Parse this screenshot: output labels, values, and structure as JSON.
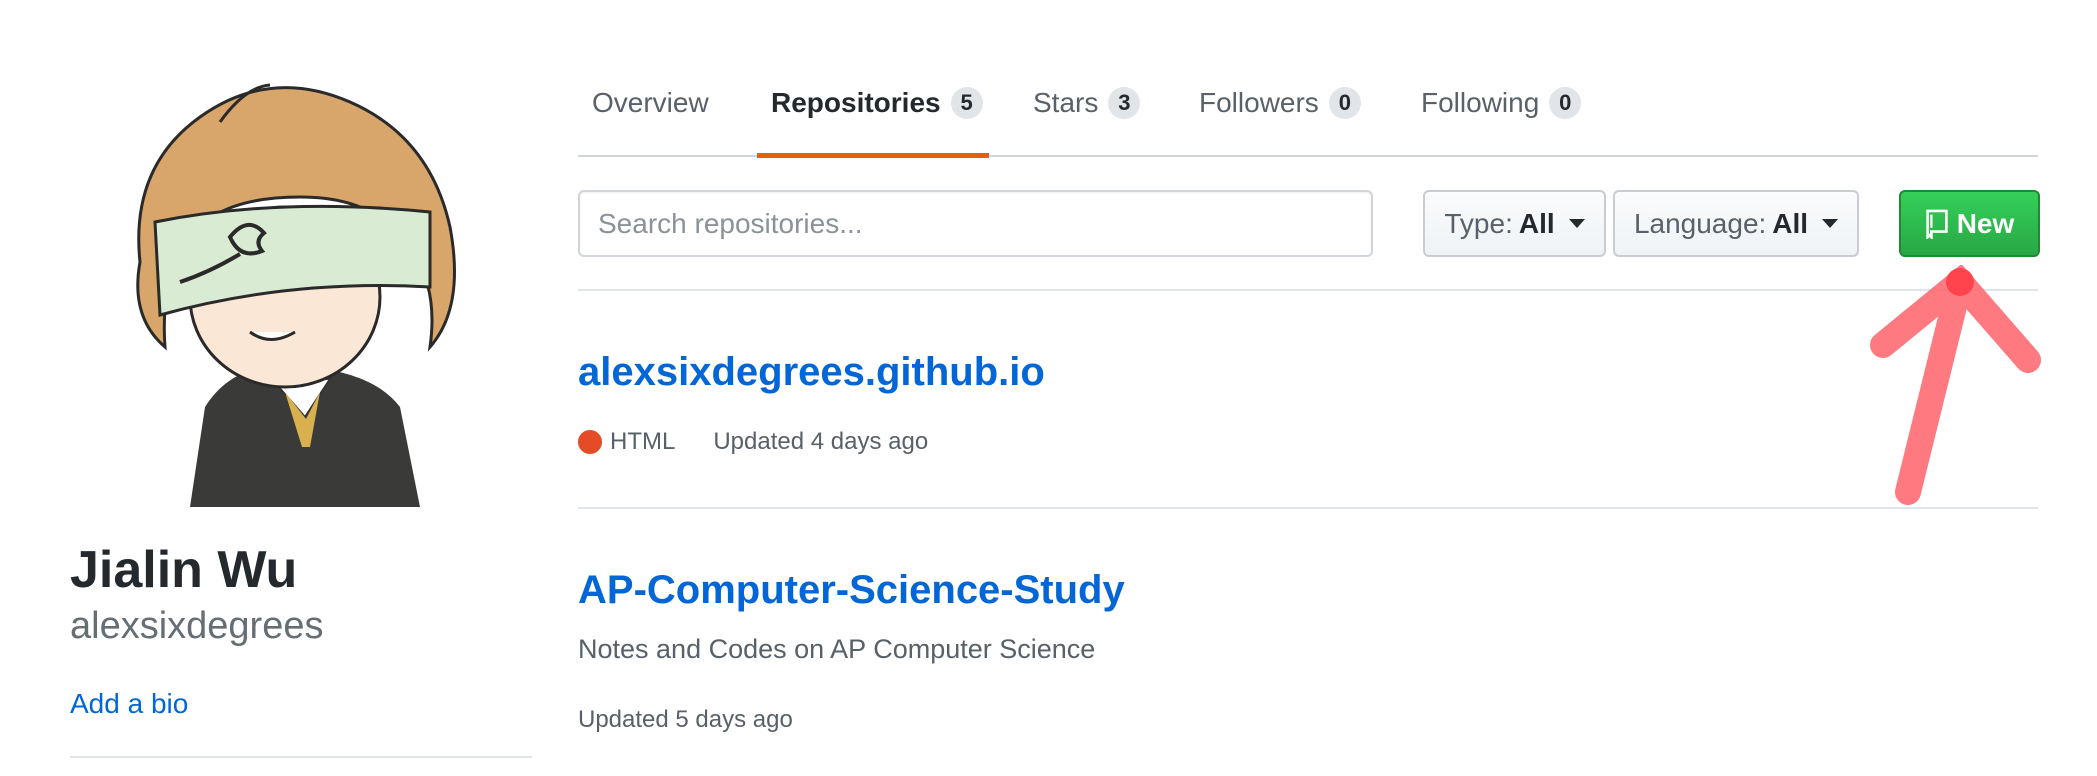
{
  "profile": {
    "full_name": "Jialin Wu",
    "username": "alexsixdegrees",
    "add_bio_label": "Add a bio"
  },
  "tabs": [
    {
      "label": "Overview",
      "count": null,
      "active": false
    },
    {
      "label": "Repositories",
      "count": "5",
      "active": true
    },
    {
      "label": "Stars",
      "count": "3",
      "active": false
    },
    {
      "label": "Followers",
      "count": "0",
      "active": false
    },
    {
      "label": "Following",
      "count": "0",
      "active": false
    }
  ],
  "toolbar": {
    "search_placeholder": "Search repositories...",
    "type_label": "Type:",
    "type_value": "All",
    "language_label": "Language:",
    "language_value": "All",
    "new_label": "New"
  },
  "repos": [
    {
      "name": "alexsixdegrees.github.io",
      "language": "HTML",
      "language_color": "#e34c26",
      "updated": "Updated 4 days ago"
    },
    {
      "name": "AP-Computer-Science-Study",
      "description": "Notes and Codes on AP Computer Science",
      "updated": "Updated 5 days ago"
    }
  ],
  "colors": {
    "link": "#0366d6",
    "active_tab_underline": "#e36209",
    "new_button": "#28a745",
    "annotation_arrow": "#ff6b73"
  },
  "icons": {
    "new_button_icon": "repo-book-icon",
    "annotation": "red-arrow-icon"
  }
}
